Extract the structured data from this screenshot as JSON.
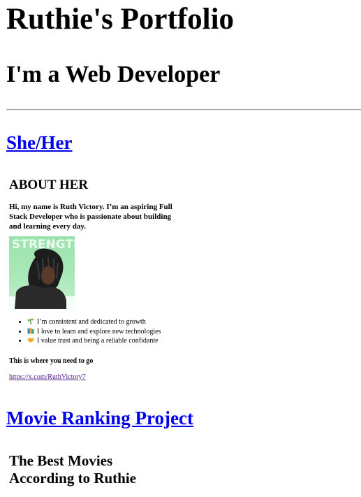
{
  "header": {
    "title": "Ruthie's Portfolio",
    "subtitle": "I'm a Web Developer"
  },
  "pronouns_link": "She/Her",
  "about": {
    "heading": "ABOUT HER",
    "intro": "Hi, my name is Ruth Victory. I’m an aspiring Full Stack Developer who is passionate about building and learning every day.",
    "photo_text": "STRENGTH",
    "traits": [
      {
        "icon": "seedling-icon",
        "text": "I’m consistent and dedicated to growth"
      },
      {
        "icon": "books-icon",
        "text": "I love to learn and explore new technologies"
      },
      {
        "icon": "handshake-icon",
        "text": "I value trust and being a reliable confidante"
      }
    ],
    "go_text": "This is where you need to go",
    "profile_link": "https://x.com/RuthVictory7"
  },
  "movie_link": "Movie Ranking Project",
  "movies": {
    "heading": "The Best Movies According to Ruthie"
  },
  "colors": {
    "link": "#0000ee",
    "visited_link": "#551a8b",
    "photo_bg": "#a9e8b8"
  }
}
